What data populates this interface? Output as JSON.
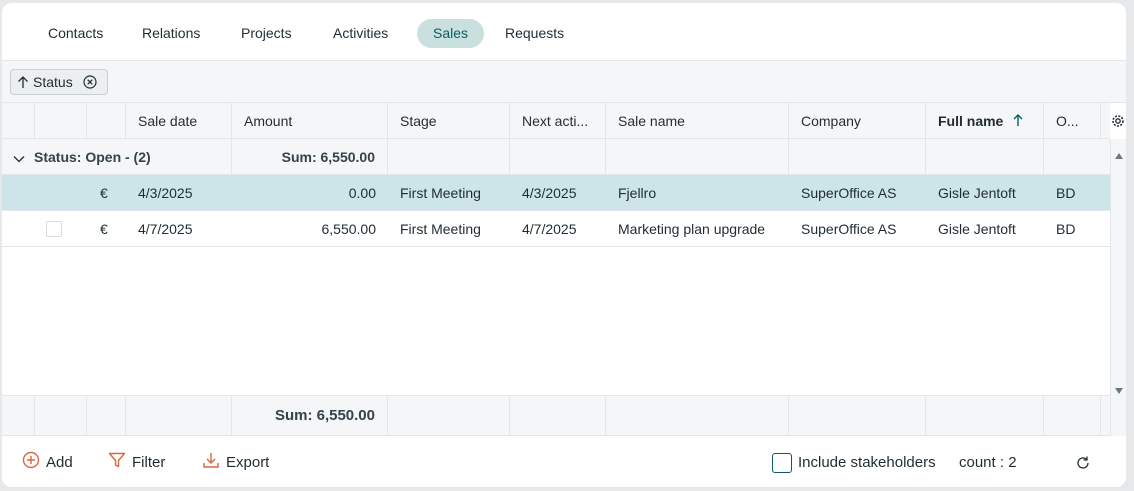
{
  "tabs": [
    {
      "label": "Contacts",
      "active": false
    },
    {
      "label": "Relations",
      "active": false
    },
    {
      "label": "Projects",
      "active": false
    },
    {
      "label": "Activities",
      "active": false
    },
    {
      "label": "Sales",
      "active": true
    },
    {
      "label": "Requests",
      "active": false
    }
  ],
  "filter_chip": {
    "label": "Status",
    "icon_sort": "arrow-up-icon",
    "icon_remove": "close-circle-icon"
  },
  "columns": [
    "Sale date",
    "Amount",
    "Stage",
    "Next acti...",
    "Sale name",
    "Company",
    "Full name",
    "O..."
  ],
  "sorted_column": "Full name",
  "group": {
    "label": "Status: Open - (2)",
    "sum": "Sum: 6,550.00",
    "expanded": true
  },
  "rows": [
    {
      "currency": "€",
      "sale_date": "4/3/2025",
      "amount": "0.00",
      "stage": "First Meeting",
      "next_action": "4/3/2025",
      "sale_name": "Fjellro",
      "company": "SuperOffice AS",
      "full_name": "Gisle Jentoft",
      "owner": "BD",
      "selected": true
    },
    {
      "currency": "€",
      "sale_date": "4/7/2025",
      "amount": "6,550.00",
      "stage": "First Meeting",
      "next_action": "4/7/2025",
      "sale_name": "Marketing plan upgrade",
      "company": "SuperOffice AS",
      "full_name": "Gisle Jentoft",
      "owner": "BD",
      "selected": false
    }
  ],
  "total_sum": "Sum: 6,550.00",
  "footer": {
    "add_label": "Add",
    "filter_label": "Filter",
    "export_label": "Export",
    "include_stakeholders_label": "Include stakeholders",
    "include_stakeholders_checked": false,
    "count_label": "count : 2"
  },
  "colors": {
    "accent": "#0b5d63",
    "active_tab_bg": "#c9e0df",
    "selected_row": "#cde4e8",
    "icon_orange": "#e0643b"
  }
}
